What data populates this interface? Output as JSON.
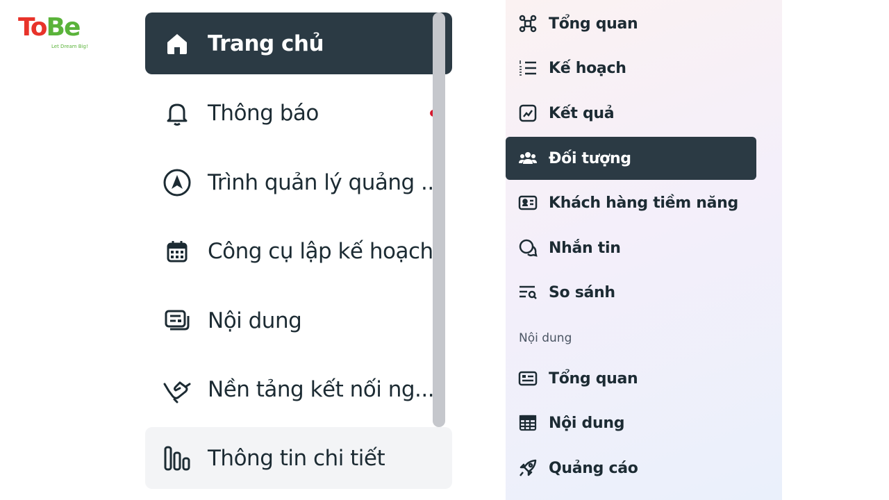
{
  "logo": {
    "text": "ToBe",
    "tagline": "Let Dream Big!"
  },
  "left_nav": {
    "items": [
      {
        "label": "Trang chủ",
        "icon": "home-icon",
        "state": "active"
      },
      {
        "label": "Thông báo",
        "icon": "bell-icon",
        "state": "default"
      },
      {
        "label": "Trình quản lý quảng ...",
        "icon": "navigation-arrow-icon",
        "state": "default"
      },
      {
        "label": "Công cụ lập kế hoạch",
        "icon": "calendar-icon",
        "state": "default"
      },
      {
        "label": "Nội dung",
        "icon": "content-stack-icon",
        "state": "default"
      },
      {
        "label": "Nền tảng kết nối ng...",
        "icon": "handshake-icon",
        "state": "default"
      },
      {
        "label": "Thông tin chi tiết",
        "icon": "bar-chart-icon",
        "state": "hover"
      }
    ]
  },
  "right_nav": {
    "items": [
      {
        "label": "Tổng quan",
        "icon": "network-nodes-icon"
      },
      {
        "label": "Kế hoạch",
        "icon": "numbered-list-icon"
      },
      {
        "label": "Kết quả",
        "icon": "line-chart-icon"
      },
      {
        "label": "Đối tượng",
        "icon": "people-icon",
        "state": "active"
      },
      {
        "label": "Khách hàng tiềm năng",
        "icon": "contact-card-icon"
      },
      {
        "label": "Nhắn tin",
        "icon": "chat-bubbles-icon"
      },
      {
        "label": "So sánh",
        "icon": "list-search-icon"
      }
    ],
    "section_label": "Nội dung",
    "section_items": [
      {
        "label": "Tổng quan",
        "icon": "id-card-icon"
      },
      {
        "label": "Nội dung",
        "icon": "table-grid-icon"
      },
      {
        "label": "Quảng cáo",
        "icon": "rocket-icon"
      }
    ]
  },
  "colors": {
    "active_bg": "#2b3a44",
    "notification_dot": "#d6192e",
    "scrollbar": "#c5c7cc"
  }
}
